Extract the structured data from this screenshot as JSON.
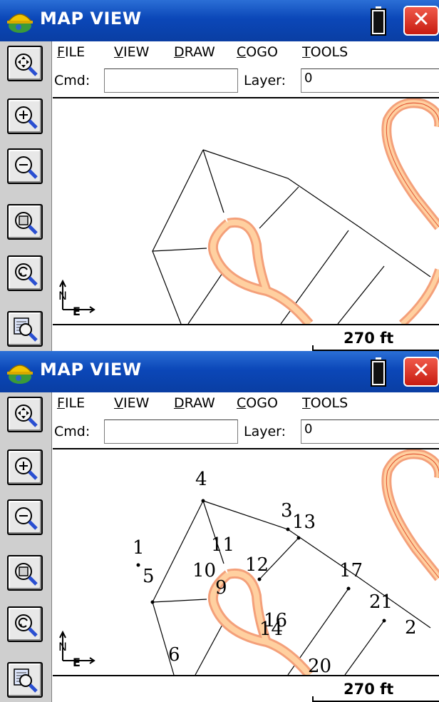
{
  "panels": [
    {
      "title": "MAP VIEW",
      "menu": [
        "FILE",
        "VIEW",
        "DRAW",
        "COGO",
        "TOOLS"
      ],
      "cmd_label": "Cmd:",
      "cmd_value": "",
      "layer_label": "Layer:",
      "layer_value": "0",
      "scale": "270 ft",
      "north_label": "N",
      "east_label": "E",
      "point_labels": []
    },
    {
      "title": "MAP VIEW",
      "menu": [
        "FILE",
        "VIEW",
        "DRAW",
        "COGO",
        "TOOLS"
      ],
      "cmd_label": "Cmd:",
      "cmd_value": "",
      "layer_label": "Layer:",
      "layer_value": "0",
      "scale": "270 ft",
      "north_label": "N",
      "east_label": "E",
      "point_labels": [
        "4",
        "3",
        "13",
        "1",
        "11",
        "12",
        "17",
        "5",
        "10",
        "9",
        "21",
        "16",
        "14",
        "2",
        "6",
        "20"
      ]
    }
  ],
  "icons": {
    "tools": [
      "zoom-extents-icon",
      "zoom-in-icon",
      "zoom-out-icon",
      "zoom-window-icon",
      "zoom-previous-icon",
      "zoom-layer-icon"
    ],
    "app": "helmet-globe-icon",
    "battery": "battery-icon",
    "close": "close-icon"
  },
  "colors": {
    "titlebar": "#0b47b8",
    "close": "#d9261a",
    "road_outer": "#f4a07a",
    "road_inner": "#ffd0a0"
  }
}
